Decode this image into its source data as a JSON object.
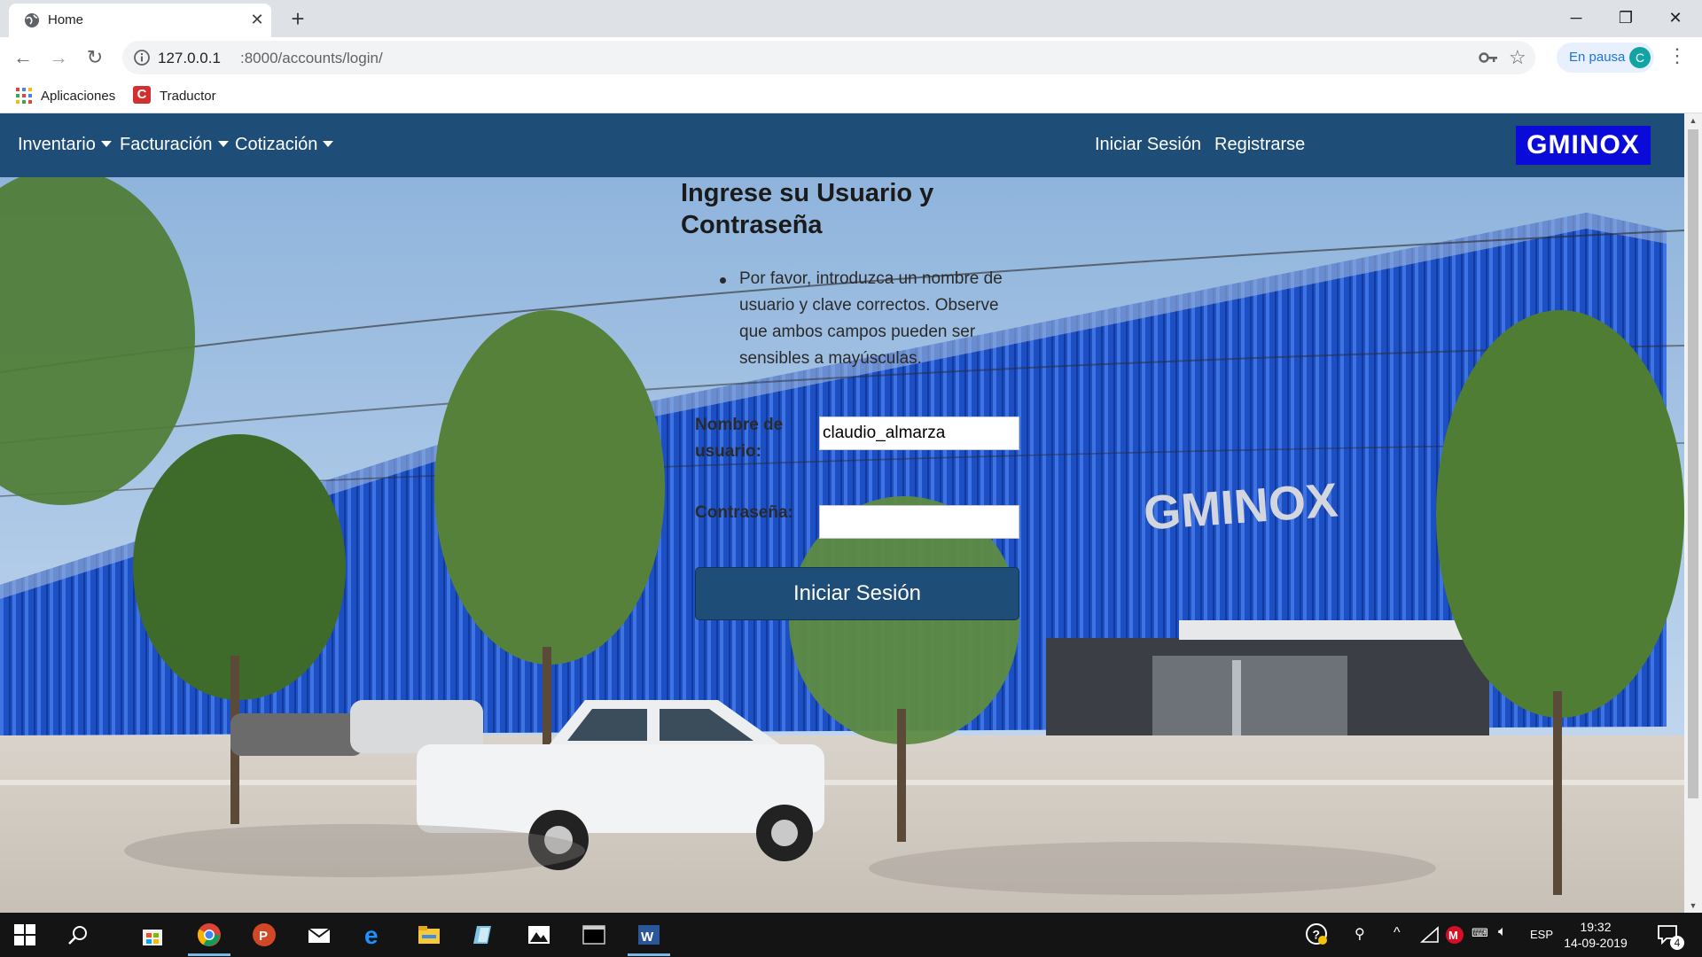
{
  "browser": {
    "tab_title": "Home",
    "url_host": "127.0.0.1",
    "url_path": ":8000/accounts/login/",
    "profile_label": "En pausa",
    "profile_initial": "C",
    "bookmarks": [
      {
        "label": "Aplicaciones",
        "icon": "apps-grid-icon"
      },
      {
        "label": "Traductor",
        "icon": "translator-icon"
      }
    ]
  },
  "navbar": {
    "menus": [
      "Inventario",
      "Facturación",
      "Cotización"
    ],
    "login_link": "Iniciar Sesión",
    "register_link": "Registrarse",
    "brand": "GMINOX",
    "background": "#1e4d78"
  },
  "login": {
    "heading": "Ingrese su Usuario y Contraseña",
    "message": "Por favor, introduzca un nombre de usuario y clave correctos. Observe que ambos campos pueden ser sensibles a mayúsculas.",
    "username_label": "Nombre de usuario:",
    "username_value": "claudio_almarza",
    "password_label": "Contraseña:",
    "password_value": "",
    "submit_label": "Iniciar Sesión"
  },
  "hero": {
    "building_sign": "GMINOX"
  },
  "taskbar": {
    "language": "ESP",
    "time": "19:32",
    "date": "14-09-2019",
    "notification_count": "4"
  }
}
